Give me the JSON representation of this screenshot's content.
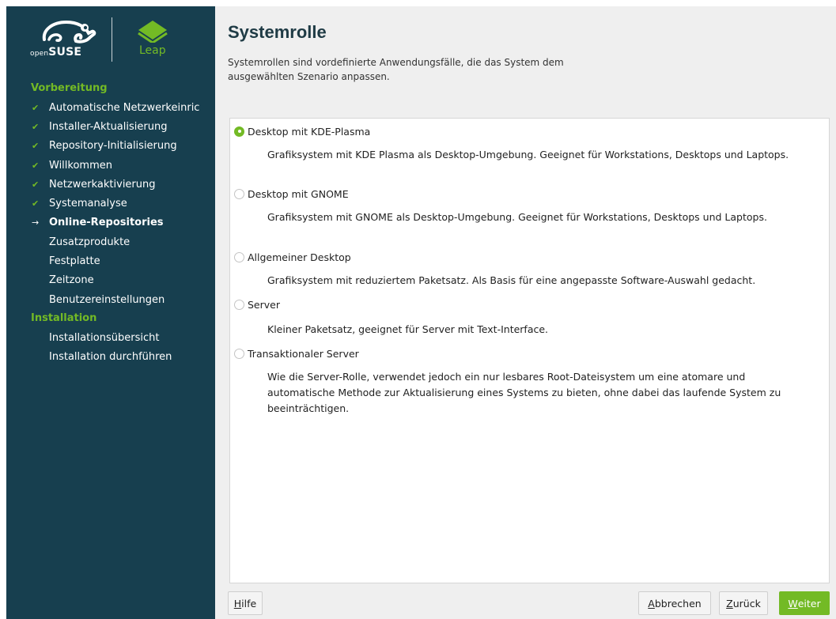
{
  "branding": {
    "suse_small": "open",
    "suse_big": "SUSE",
    "leap": "Leap"
  },
  "sidebar": {
    "sections": [
      {
        "title": "Vorbereitung",
        "items": [
          {
            "label": "Automatische Netzwerkeinric",
            "state": "done"
          },
          {
            "label": "Installer-Aktualisierung",
            "state": "done"
          },
          {
            "label": "Repository-Initialisierung",
            "state": "done"
          },
          {
            "label": "Willkommen",
            "state": "done"
          },
          {
            "label": "Netzwerkaktivierung",
            "state": "done"
          },
          {
            "label": "Systemanalyse",
            "state": "done"
          },
          {
            "label": "Online-Repositories",
            "state": "current"
          },
          {
            "label": "Zusatzprodukte",
            "state": "pending"
          },
          {
            "label": "Festplatte",
            "state": "pending"
          },
          {
            "label": "Zeitzone",
            "state": "pending"
          },
          {
            "label": "Benutzereinstellungen",
            "state": "pending"
          }
        ]
      },
      {
        "title": "Installation",
        "items": [
          {
            "label": "Installationsübersicht",
            "state": "pending"
          },
          {
            "label": "Installation durchführen",
            "state": "pending"
          }
        ]
      }
    ],
    "done_mark": "✔",
    "current_mark": "→"
  },
  "main": {
    "title": "Systemrolle",
    "description": "Systemrollen sind vordefinierte Anwendungsfälle, die das System dem ausgewählten Szenario anpassen.",
    "roles": [
      {
        "label": "Desktop mit KDE-Plasma",
        "selected": true,
        "description": "Grafiksystem mit KDE Plasma als Desktop-Umgebung. Geeignet für Workstations, Desktops und Laptops."
      },
      {
        "label": "Desktop mit GNOME",
        "selected": false,
        "description": "Grafiksystem mit GNOME als Desktop-Umgebung. Geeignet für Workstations, Desktops und Laptops."
      },
      {
        "label": "Allgemeiner Desktop",
        "selected": false,
        "description": "Grafiksystem mit reduziertem Paketsatz. Als Basis für eine angepasste Software-Auswahl gedacht."
      },
      {
        "label": "Server",
        "selected": false,
        "description": "Kleiner Paketsatz, geeignet für Server mit Text-Interface."
      },
      {
        "label": "Transaktionaler Server",
        "selected": false,
        "description": "Wie die Server-Rolle, verwendet jedoch ein nur lesbares Root-Dateisystem um eine atomare und automatische Methode zur Aktualisierung eines Systems zu bieten, ohne dabei das laufende System zu beeinträchtigen."
      }
    ]
  },
  "buttons": {
    "help": {
      "mnemonic": "H",
      "rest": "ilfe"
    },
    "abort": {
      "mnemonic": "A",
      "rest": "bbrechen"
    },
    "back": {
      "mnemonic": "Z",
      "rest": "urück"
    },
    "next": {
      "mnemonic": "W",
      "rest": "eiter"
    }
  },
  "colors": {
    "sidebar_bg": "#173f4f",
    "accent_green": "#73ba25",
    "main_bg": "#efefef"
  }
}
